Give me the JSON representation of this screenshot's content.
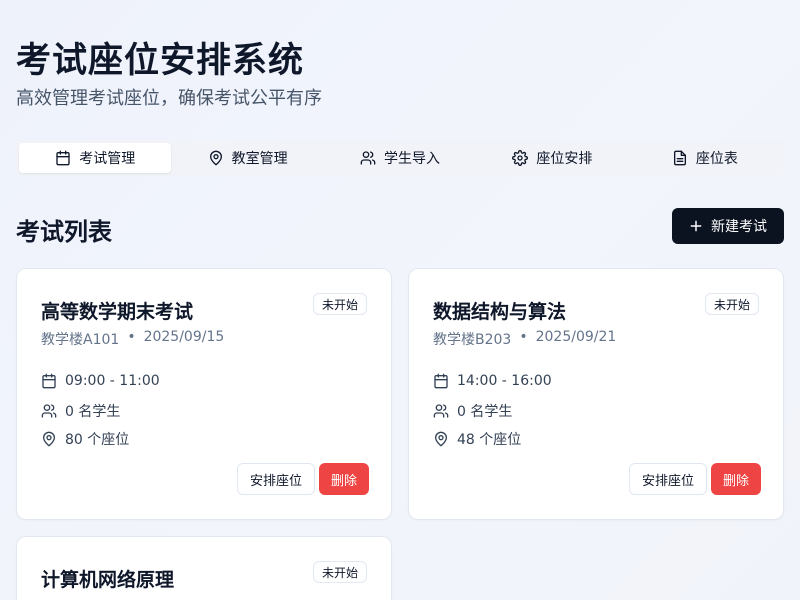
{
  "header": {
    "title": "考试座位安排系统",
    "subtitle": "高效管理考试座位，确保考试公平有序"
  },
  "tabs": [
    {
      "label": "考试管理",
      "icon": "calendar-icon",
      "active": true
    },
    {
      "label": "教室管理",
      "icon": "map-pin-icon",
      "active": false
    },
    {
      "label": "学生导入",
      "icon": "users-icon",
      "active": false
    },
    {
      "label": "座位安排",
      "icon": "gear-icon",
      "active": false
    },
    {
      "label": "座位表",
      "icon": "document-icon",
      "active": false
    }
  ],
  "section": {
    "title": "考试列表",
    "new_button": "新建考试"
  },
  "exams": [
    {
      "title": "高等数学期末考试",
      "status": "未开始",
      "room": "教学楼A101",
      "separator": "•",
      "date": "2025/09/15",
      "time": "09:00 - 11:00",
      "students": "0 名学生",
      "seats": "80 个座位",
      "arrange_label": "安排座位",
      "delete_label": "删除"
    },
    {
      "title": "数据结构与算法",
      "status": "未开始",
      "room": "教学楼B203",
      "separator": "•",
      "date": "2025/09/21",
      "time": "14:00 - 16:00",
      "students": "0 名学生",
      "seats": "48 个座位",
      "arrange_label": "安排座位",
      "delete_label": "删除"
    },
    {
      "title": "计算机网络原理",
      "status": "未开始"
    }
  ],
  "colors": {
    "primary_dark": "#0b1220",
    "danger": "#ef4444",
    "muted_text": "#64748b"
  }
}
